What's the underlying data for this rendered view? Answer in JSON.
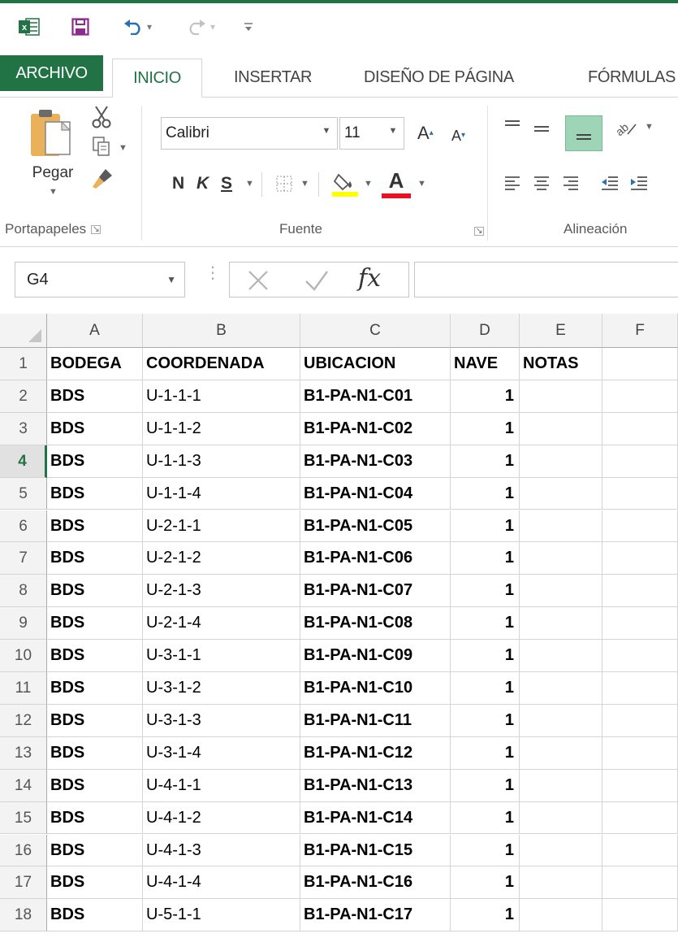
{
  "app": {
    "name": "Excel",
    "accent_color": "#217346"
  },
  "quick_access": {
    "logo_letter": "x",
    "items": [
      "excel-logo-icon",
      "save-icon",
      "undo-icon",
      "redo-icon",
      "customize-qat-icon"
    ]
  },
  "tabs": {
    "archivo": "ARCHIVO",
    "inicio": "INICIO",
    "insertar": "INSERTAR",
    "diseno": "DISEÑO DE PÁGINA",
    "formulas": "FÓRMULAS",
    "active": "INICIO"
  },
  "ribbon": {
    "clipboard": {
      "label": "Portapapeles",
      "paste_label": "Pegar"
    },
    "font": {
      "label": "Fuente",
      "font_name": "Calibri",
      "font_size": "11",
      "grow_label": "A",
      "shrink_label": "A",
      "bold_label": "N",
      "italic_label": "K",
      "underline_label": "S",
      "fill_color": "#ffff00",
      "font_color": "#e81123",
      "font_color_label": "A"
    },
    "alignment": {
      "label": "Alineación"
    }
  },
  "formula_bar": {
    "name_box": "G4",
    "fx_label": "fx",
    "formula": ""
  },
  "grid": {
    "columns": [
      "A",
      "B",
      "C",
      "D",
      "E",
      "F"
    ],
    "row_numbers": [
      "1",
      "2",
      "3",
      "4",
      "5",
      "6",
      "7",
      "8",
      "9",
      "10",
      "11",
      "12",
      "13",
      "14",
      "15",
      "16",
      "17",
      "18"
    ],
    "active_row": "4",
    "header_row": [
      "BODEGA",
      "COORDENADA",
      "UBICACION",
      "NAVE",
      "NOTAS"
    ],
    "rows": [
      [
        "BDS",
        "U-1-1-1",
        "B1-PA-N1-C01",
        "1"
      ],
      [
        "BDS",
        "U-1-1-2",
        "B1-PA-N1-C02",
        "1"
      ],
      [
        "BDS",
        "U-1-1-3",
        "B1-PA-N1-C03",
        "1"
      ],
      [
        "BDS",
        "U-1-1-4",
        "B1-PA-N1-C04",
        "1"
      ],
      [
        "BDS",
        "U-2-1-1",
        "B1-PA-N1-C05",
        "1"
      ],
      [
        "BDS",
        "U-2-1-2",
        "B1-PA-N1-C06",
        "1"
      ],
      [
        "BDS",
        "U-2-1-3",
        "B1-PA-N1-C07",
        "1"
      ],
      [
        "BDS",
        "U-2-1-4",
        "B1-PA-N1-C08",
        "1"
      ],
      [
        "BDS",
        "U-3-1-1",
        "B1-PA-N1-C09",
        "1"
      ],
      [
        "BDS",
        "U-3-1-2",
        "B1-PA-N1-C10",
        "1"
      ],
      [
        "BDS",
        "U-3-1-3",
        "B1-PA-N1-C11",
        "1"
      ],
      [
        "BDS",
        "U-3-1-4",
        "B1-PA-N1-C12",
        "1"
      ],
      [
        "BDS",
        "U-4-1-1",
        "B1-PA-N1-C13",
        "1"
      ],
      [
        "BDS",
        "U-4-1-2",
        "B1-PA-N1-C14",
        "1"
      ],
      [
        "BDS",
        "U-4-1-3",
        "B1-PA-N1-C15",
        "1"
      ],
      [
        "BDS",
        "U-4-1-4",
        "B1-PA-N1-C16",
        "1"
      ],
      [
        "BDS",
        "U-5-1-1",
        "B1-PA-N1-C17",
        "1"
      ]
    ]
  }
}
